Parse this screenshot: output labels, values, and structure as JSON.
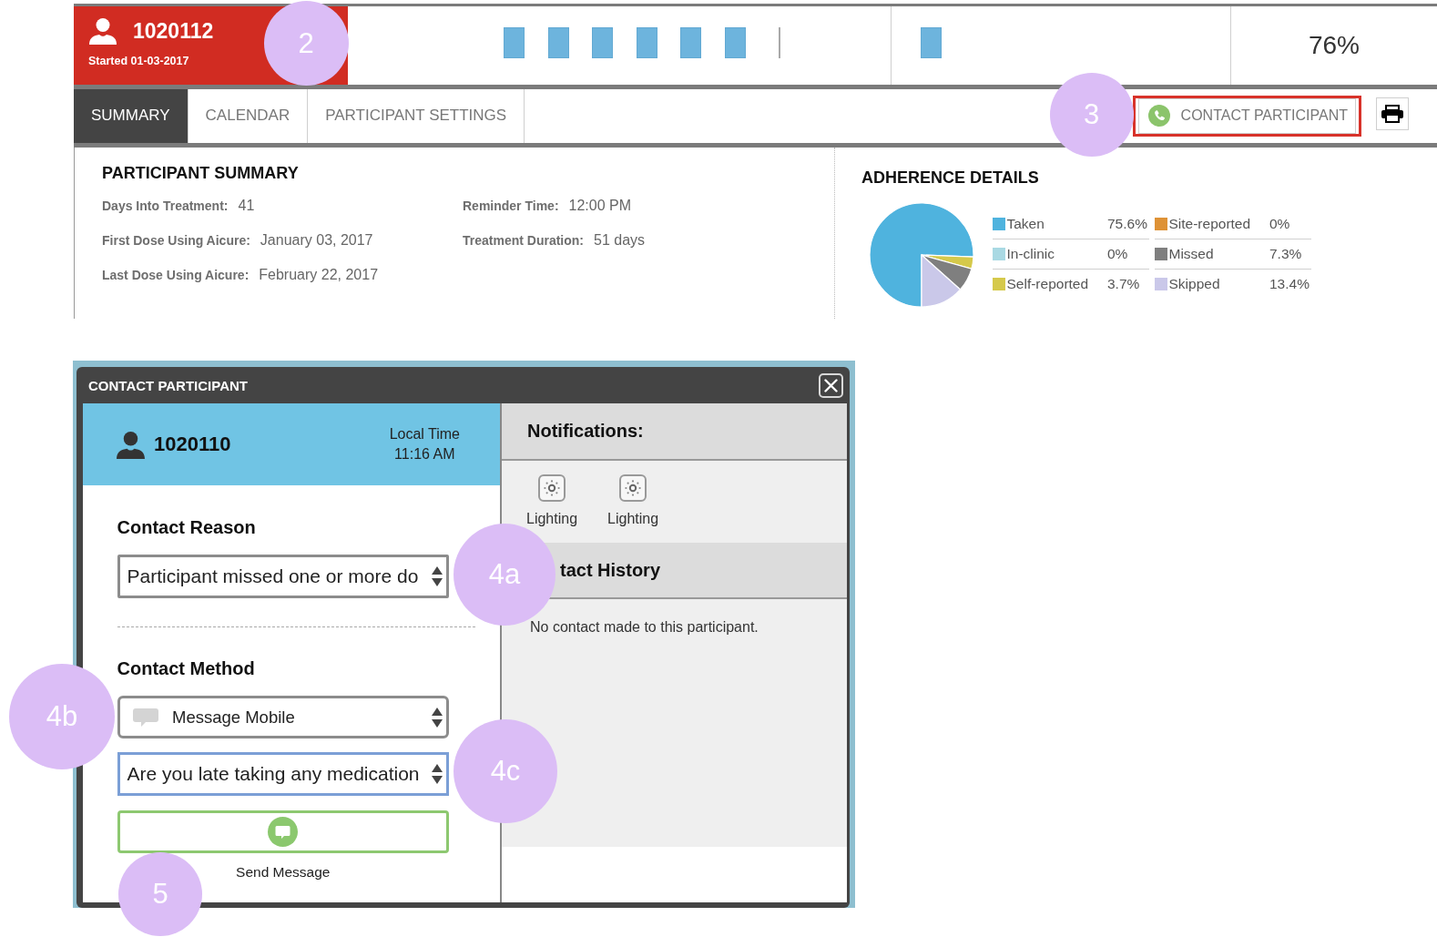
{
  "header": {
    "participant_id": "1020112",
    "started": "Started 01-03-2017",
    "callout": "2",
    "timeline": [
      {
        "marks": [
          {
            "kind": "square"
          },
          {
            "kind": "square"
          },
          {
            "kind": "square"
          },
          {
            "kind": "square"
          },
          {
            "kind": "square"
          },
          {
            "kind": "square"
          },
          {
            "kind": "line"
          }
        ]
      },
      {
        "marks": [
          {
            "kind": "square"
          }
        ]
      }
    ],
    "adherence_percent": "76%"
  },
  "tabs": [
    {
      "label": "SUMMARY",
      "selected": true
    },
    {
      "label": "CALENDAR",
      "selected": false
    },
    {
      "label": "PARTICIPANT SETTINGS",
      "selected": false
    }
  ],
  "contact_button": {
    "label": "CONTACT PARTICIPANT",
    "highlighted": true,
    "callout": "3"
  },
  "participant_summary": {
    "title": "PARTICIPANT SUMMARY",
    "columns": [
      [
        {
          "label": "Days Into Treatment:",
          "value": "41"
        },
        {
          "label": "First Dose Using Aicure:",
          "value": "January 03, 2017"
        },
        {
          "label": "Last Dose Using Aicure:",
          "value": "February 22, 2017"
        }
      ],
      [
        {
          "label": "Reminder Time:",
          "value": "12:00 PM"
        },
        {
          "label": "Treatment Duration:",
          "value": "51 days"
        }
      ]
    ]
  },
  "adherence": {
    "title": "ADHERENCE DETAILS",
    "chart_data": {
      "type": "pie",
      "categories": [
        "Taken",
        "In-clinic",
        "Self-reported",
        "Site-reported",
        "Missed",
        "Skipped"
      ],
      "values": [
        75.6,
        0,
        3.7,
        0,
        7.3,
        13.4
      ]
    },
    "legend": [
      {
        "value": "75.6%",
        "color": "#4fb3de"
      },
      {
        "value": "0%",
        "color": "#a9d9e3"
      },
      {
        "value": "3.7%",
        "color": "#d5c94b"
      },
      {
        "value": "0%",
        "color": "#de9236"
      },
      {
        "value": "7.3%",
        "color": "#7f7f7f"
      },
      {
        "value": "13.4%",
        "color": "#cac8e9"
      }
    ]
  },
  "dialog": {
    "title": "CONTACT PARTICIPANT",
    "participant": {
      "id": "1020110",
      "local_time_label": "Local Time",
      "local_time": "11:16 AM"
    },
    "contact_reason": {
      "heading": "Contact Reason",
      "value": "Participant missed one or more do",
      "callout": "4a"
    },
    "contact_method": {
      "heading": "Contact Method",
      "method": {
        "value": "Message Mobile",
        "callout": "4b"
      },
      "message": {
        "value": "Are you late taking any medication",
        "focused": true,
        "callout": "4c"
      }
    },
    "send": {
      "label": "Send Message",
      "callout": "5"
    },
    "notifications": {
      "heading": "Notifications:",
      "items": [
        {
          "label": "Lighting"
        },
        {
          "label": "Lighting"
        }
      ]
    },
    "contact_history": {
      "heading": "tact History",
      "empty_text": "No contact made to this participant."
    }
  }
}
